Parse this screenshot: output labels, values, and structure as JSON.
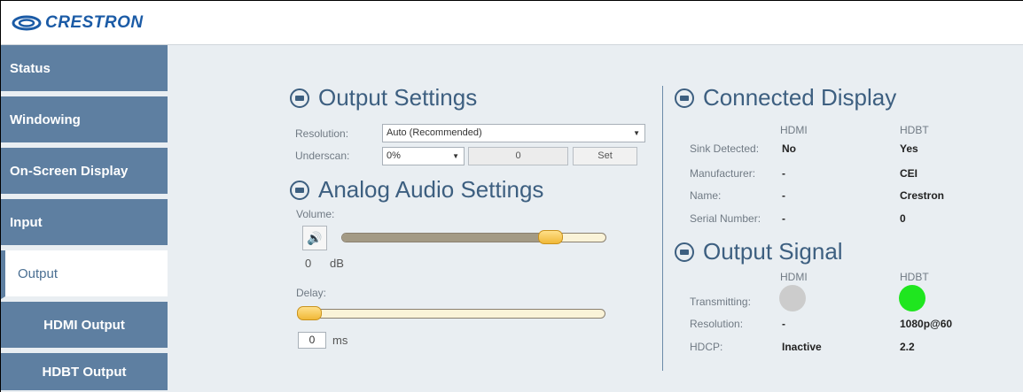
{
  "brand": {
    "name": "CRESTRON"
  },
  "sidebar": {
    "items": [
      {
        "label": "Status"
      },
      {
        "label": "Windowing"
      },
      {
        "label": "On-Screen Display"
      },
      {
        "label": "Input"
      },
      {
        "label": "Output"
      },
      {
        "label": "HDMI Output"
      },
      {
        "label": "HDBT Output"
      }
    ]
  },
  "output_settings": {
    "title": "Output Settings",
    "resolution_label": "Resolution:",
    "resolution_value": "Auto (Recommended)",
    "underscan_label": "Underscan:",
    "underscan_value": "0%",
    "underscan_number": "0",
    "set_label": "Set"
  },
  "analog_audio": {
    "title": "Analog Audio Settings",
    "volume_label": "Volume:",
    "volume_value": "0",
    "volume_unit": "dB",
    "volume_level": 0.82,
    "delay_label": "Delay:",
    "delay_value": "0",
    "delay_unit": "ms",
    "delay_level": 0.0
  },
  "connected_display": {
    "title": "Connected Display",
    "col_hdmi": "HDMI",
    "col_hdbt": "HDBT",
    "rows": [
      {
        "label": "Sink Detected:",
        "hdmi": "No",
        "hdbt": "Yes"
      },
      {
        "label": "Manufacturer:",
        "hdmi": "-",
        "hdbt": "CEI"
      },
      {
        "label": "Name:",
        "hdmi": "-",
        "hdbt": "Crestron"
      },
      {
        "label": "Serial Number:",
        "hdmi": "-",
        "hdbt": "0"
      }
    ]
  },
  "output_signal": {
    "title": "Output Signal",
    "col_hdmi": "HDMI",
    "col_hdbt": "HDBT",
    "transmitting_label": "Transmitting:",
    "transmitting_hdmi_color": "#cccccc",
    "transmitting_hdbt_color": "#1fe61f",
    "resolution_label": "Resolution:",
    "resolution_hdmi": "-",
    "resolution_hdbt": "1080p@60",
    "hdcp_label": "HDCP:",
    "hdcp_hdmi": "Inactive",
    "hdcp_hdbt": "2.2"
  },
  "colors": {
    "nav": "#5e7fa1",
    "heading": "#3d5f80",
    "background": "#e9eef2"
  }
}
